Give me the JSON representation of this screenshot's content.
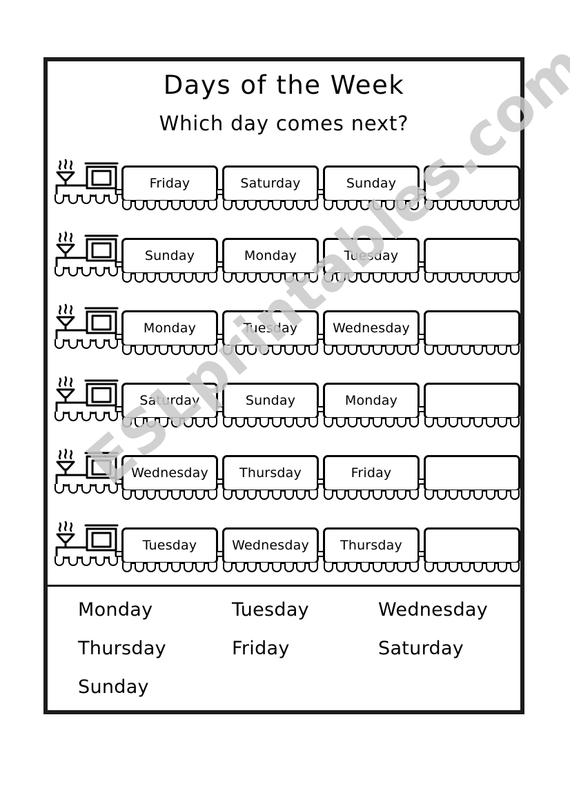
{
  "worksheet": {
    "title": "Days of the Week",
    "subtitle": "Which day comes next?",
    "watermark": "ESLprintables.com",
    "accent_color": "#000000",
    "frame_color": "#1c1c1c",
    "watermark_color": "#c9c9c9",
    "paper_color": "#ffffff"
  },
  "icons": {
    "locomotive": "train-locomotive-icon",
    "steam": "steam-puff-icon",
    "wheel": "train-wheel-icon",
    "coupler": "train-coupler-icon"
  },
  "rows": [
    {
      "row_label": "row-1",
      "cars": [
        {
          "text": "Friday",
          "blank": false
        },
        {
          "text": "Saturday",
          "blank": false
        },
        {
          "text": "Sunday",
          "blank": false
        },
        {
          "text": "",
          "blank": true
        }
      ]
    },
    {
      "row_label": "row-2",
      "cars": [
        {
          "text": "Sunday",
          "blank": false
        },
        {
          "text": "Monday",
          "blank": false
        },
        {
          "text": "Tuesday",
          "blank": false
        },
        {
          "text": "",
          "blank": true
        }
      ]
    },
    {
      "row_label": "row-3",
      "cars": [
        {
          "text": "Monday",
          "blank": false
        },
        {
          "text": "Tuesday",
          "blank": false
        },
        {
          "text": "Wednesday",
          "blank": false
        },
        {
          "text": "",
          "blank": true
        }
      ]
    },
    {
      "row_label": "row-4",
      "cars": [
        {
          "text": "Saturday",
          "blank": false
        },
        {
          "text": "Sunday",
          "blank": false
        },
        {
          "text": "Monday",
          "blank": false
        },
        {
          "text": "",
          "blank": true
        }
      ]
    },
    {
      "row_label": "row-5",
      "cars": [
        {
          "text": "Wednesday",
          "blank": false
        },
        {
          "text": "Thursday",
          "blank": false
        },
        {
          "text": "Friday",
          "blank": false
        },
        {
          "text": "",
          "blank": true
        }
      ]
    },
    {
      "row_label": "row-6",
      "cars": [
        {
          "text": "Tuesday",
          "blank": false
        },
        {
          "text": "Wednesday",
          "blank": false
        },
        {
          "text": "Thursday",
          "blank": false
        },
        {
          "text": "",
          "blank": true
        }
      ]
    }
  ],
  "word_bank": {
    "words": [
      "Monday",
      "Tuesday",
      "Wednesday",
      "Thursday",
      "Friday",
      "Saturday",
      "Sunday"
    ]
  }
}
